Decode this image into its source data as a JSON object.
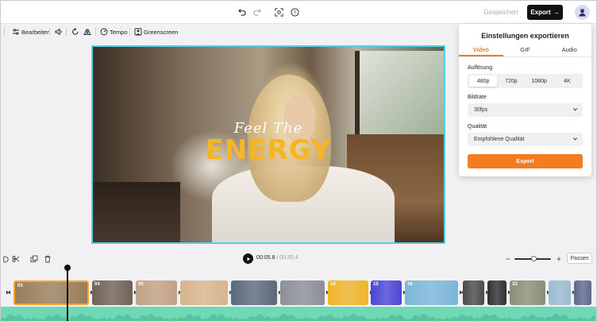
{
  "topbar": {
    "icons": [
      "undo-icon",
      "redo-icon",
      "screenshot-icon",
      "help-icon"
    ],
    "saved_label": "Gespeichert",
    "export_label": "Export",
    "export_arrow": "→"
  },
  "toolbar": {
    "edit_label": "Bearbeiten",
    "speed_label": "Tempo",
    "greenscreen_label": "Greenscreen"
  },
  "canvas": {
    "title_line1": "Feel The",
    "title_line2": "ENERGY",
    "accent_color": "#f5b526"
  },
  "export_panel": {
    "title": "Einstellungen exportieren",
    "tabs": [
      {
        "label": "Video",
        "active": true
      },
      {
        "label": "GIF",
        "active": false
      },
      {
        "label": "Audio",
        "active": false
      }
    ],
    "resolution_label": "Auflösung",
    "resolutions": [
      "480p",
      "720p",
      "1080p",
      "4K"
    ],
    "resolution_selected": "480p",
    "framerate_label": "Bildrate",
    "framerate_value": "30fps",
    "quality_label": "Qualität",
    "quality_value": "Empfohlene Qualität",
    "export_button": "Export",
    "accent_color": "#f47c20"
  },
  "timeline": {
    "current_time": "00:05.8",
    "separator": " / ",
    "total_time": "00:35.4",
    "fit_label": "Passen",
    "zoom_level": 0.5,
    "clips": [
      {
        "num": "03",
        "color": "#9a7e5a",
        "selected": true
      },
      {
        "num": "04",
        "color": "#6f6258",
        "selected": false
      },
      {
        "num": "05",
        "color": "#c2a184",
        "selected": false
      },
      {
        "num": "",
        "color": "#d8b58c",
        "selected": false
      },
      {
        "num": "",
        "color": "#5b6a7c",
        "selected": false
      },
      {
        "num": "",
        "color": "#8c8f96",
        "selected": false
      },
      {
        "num": "14",
        "color": "#f0b528",
        "selected": false
      },
      {
        "num": "15",
        "color": "#4b45d6",
        "selected": false
      },
      {
        "num": "16",
        "color": "#7ab6d8",
        "selected": false
      },
      {
        "num": "",
        "color": "#4a4a4a",
        "selected": false
      },
      {
        "num": "",
        "color": "#2f2f2f",
        "selected": false
      },
      {
        "num": "32",
        "color": "#8a8f78",
        "selected": false
      },
      {
        "num": "",
        "color": "#9bbad2",
        "selected": false
      },
      {
        "num": "",
        "color": "#5c6a8c",
        "selected": false
      }
    ],
    "audio_color": "#6fd8b5"
  }
}
